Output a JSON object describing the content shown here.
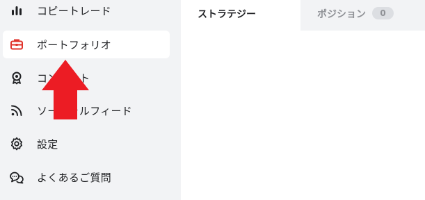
{
  "sidebar": {
    "items": [
      {
        "label": "コピートレード",
        "icon": "bar-chart-icon",
        "active": false
      },
      {
        "label": "ポートフォリオ",
        "icon": "briefcase-icon",
        "active": true
      },
      {
        "label": "コンテスト",
        "icon": "award-icon",
        "active": false
      },
      {
        "label": "ソーシャルフィード",
        "icon": "rss-feed-icon",
        "active": false
      },
      {
        "label": "設定",
        "icon": "gear-icon",
        "active": false
      },
      {
        "label": "よくあるご質問",
        "icon": "chat-bubbles-icon",
        "active": false
      }
    ]
  },
  "tabs": {
    "strategy_label": "ストラテジー",
    "position_label": "ポジション",
    "position_count": "0"
  },
  "colors": {
    "accent_red": "#e0332b",
    "arrow_red": "#ec1c24",
    "sidebar_bg": "#f2f3f5"
  }
}
